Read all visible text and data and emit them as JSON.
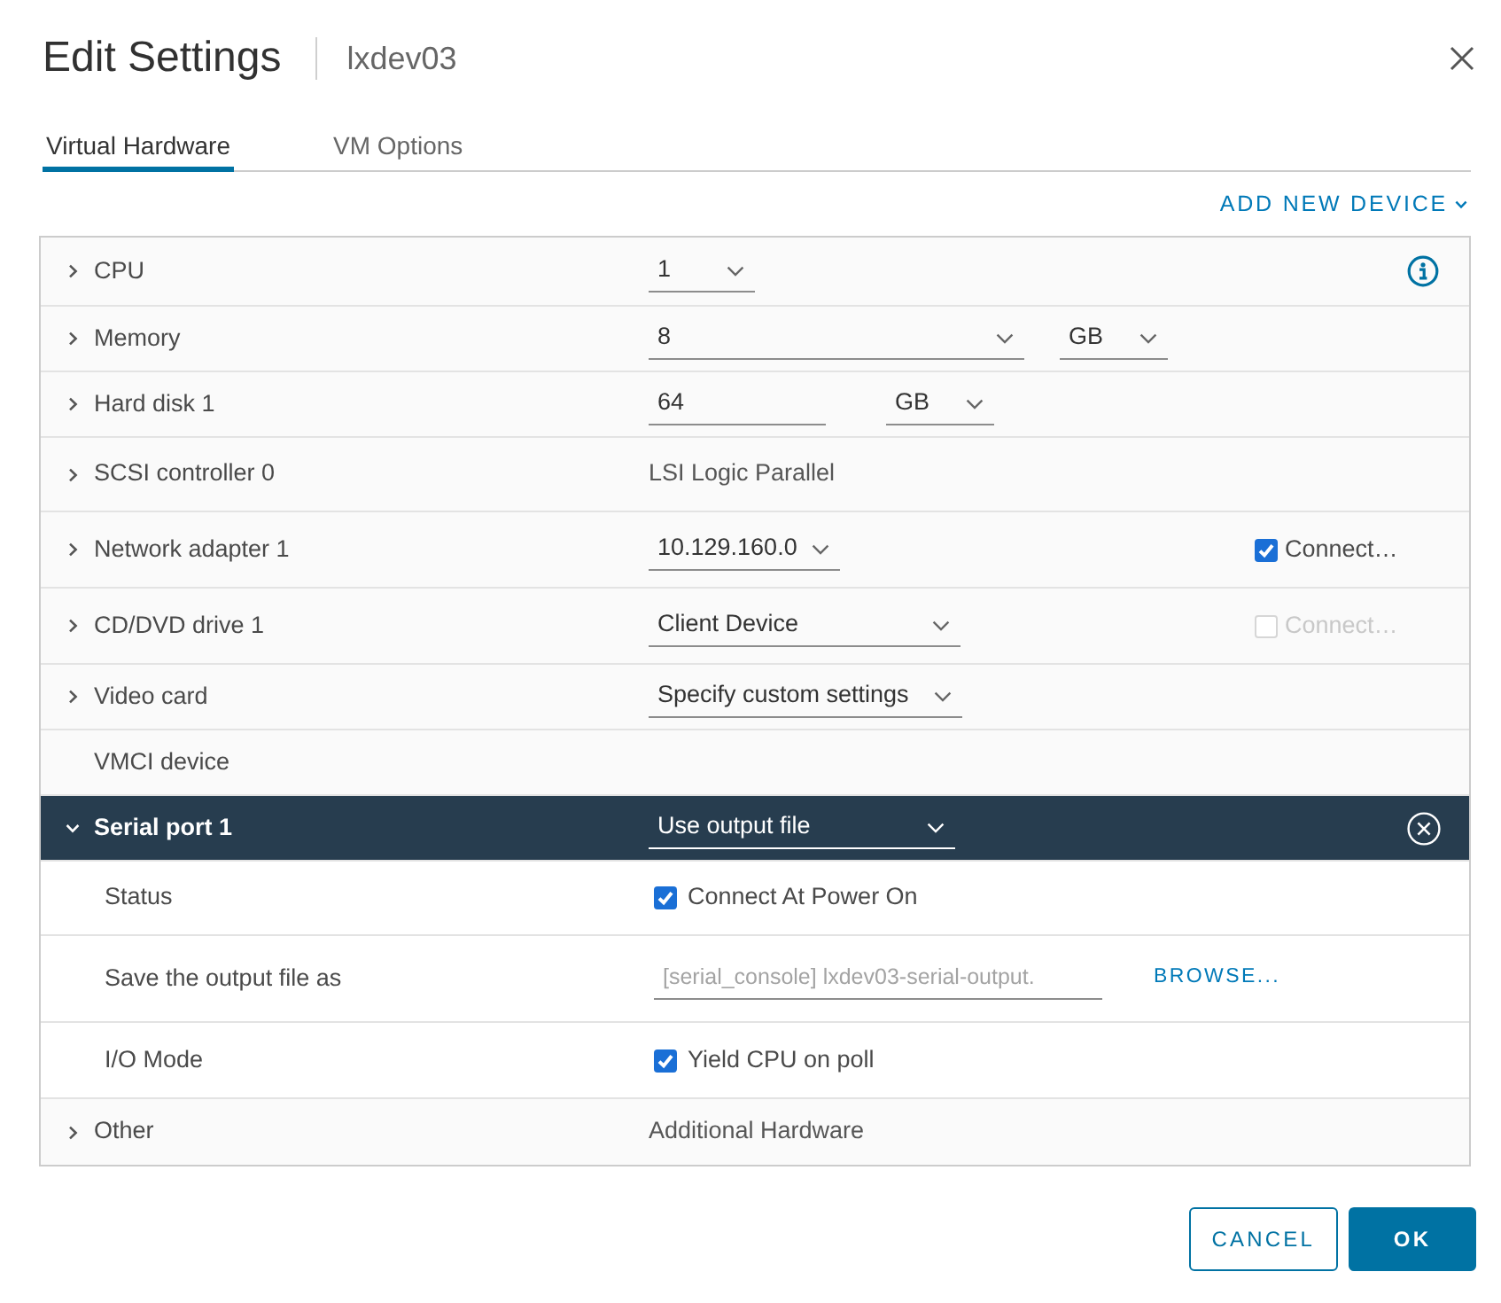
{
  "dialog": {
    "title": "Edit Settings",
    "subtitle": "lxdev03"
  },
  "tabs": [
    {
      "label": "Virtual Hardware",
      "selected": true
    },
    {
      "label": "VM Options",
      "selected": false
    }
  ],
  "add_device": {
    "label": "ADD NEW DEVICE"
  },
  "devices": [
    {
      "label": "CPU",
      "expanded": false,
      "controls": [
        {
          "kind": "select",
          "value": "1"
        }
      ],
      "info_button": true
    },
    {
      "label": "Memory",
      "expanded": false,
      "controls": [
        {
          "kind": "select",
          "value": "8"
        },
        {
          "kind": "select",
          "value": "GB"
        }
      ]
    },
    {
      "label": "Hard disk 1",
      "expanded": false,
      "controls": [
        {
          "kind": "input",
          "value": "64"
        },
        {
          "kind": "select",
          "value": "GB"
        }
      ]
    },
    {
      "label": "SCSI controller 0",
      "expanded": false,
      "controls": [
        {
          "kind": "text",
          "value": "LSI Logic Parallel"
        }
      ]
    },
    {
      "label": "Network adapter 1",
      "expanded": false,
      "controls": [
        {
          "kind": "select",
          "value": "10.129.160.0"
        }
      ],
      "connect": {
        "label": "Connect…",
        "checked": true,
        "disabled": false
      }
    },
    {
      "label": "CD/DVD drive 1",
      "expanded": false,
      "controls": [
        {
          "kind": "select",
          "value": "Client Device"
        }
      ],
      "connect": {
        "label": "Connect…",
        "checked": false,
        "disabled": true
      }
    },
    {
      "label": "Video card",
      "expanded": false,
      "controls": [
        {
          "kind": "select",
          "value": "Specify custom settings"
        }
      ]
    },
    {
      "label": "VMCI device"
    },
    {
      "label": "Serial port 1",
      "expanded": true,
      "controls": [
        {
          "kind": "select",
          "value": "Use output file"
        }
      ],
      "remove_button": true,
      "children": [
        {
          "label": "Status",
          "controls": [
            {
              "kind": "checkbox",
              "label": "Connect At Power On",
              "checked": true
            }
          ]
        },
        {
          "label": "Save the output file as",
          "controls": [
            {
              "kind": "input",
              "value": "[serial_console] lxdev03-serial-output.",
              "disabled": true
            },
            {
              "kind": "link",
              "label": "BROWSE..."
            }
          ]
        },
        {
          "label": "I/O Mode",
          "controls": [
            {
              "kind": "checkbox",
              "label": "Yield CPU on poll",
              "checked": true
            }
          ]
        }
      ]
    },
    {
      "label": "Other",
      "expanded": false,
      "controls": [
        {
          "kind": "text",
          "value": "Additional Hardware"
        }
      ]
    }
  ],
  "buttons": [
    {
      "label": "CANCEL",
      "kind": "secondary"
    },
    {
      "label": "OK",
      "kind": "primary"
    }
  ]
}
